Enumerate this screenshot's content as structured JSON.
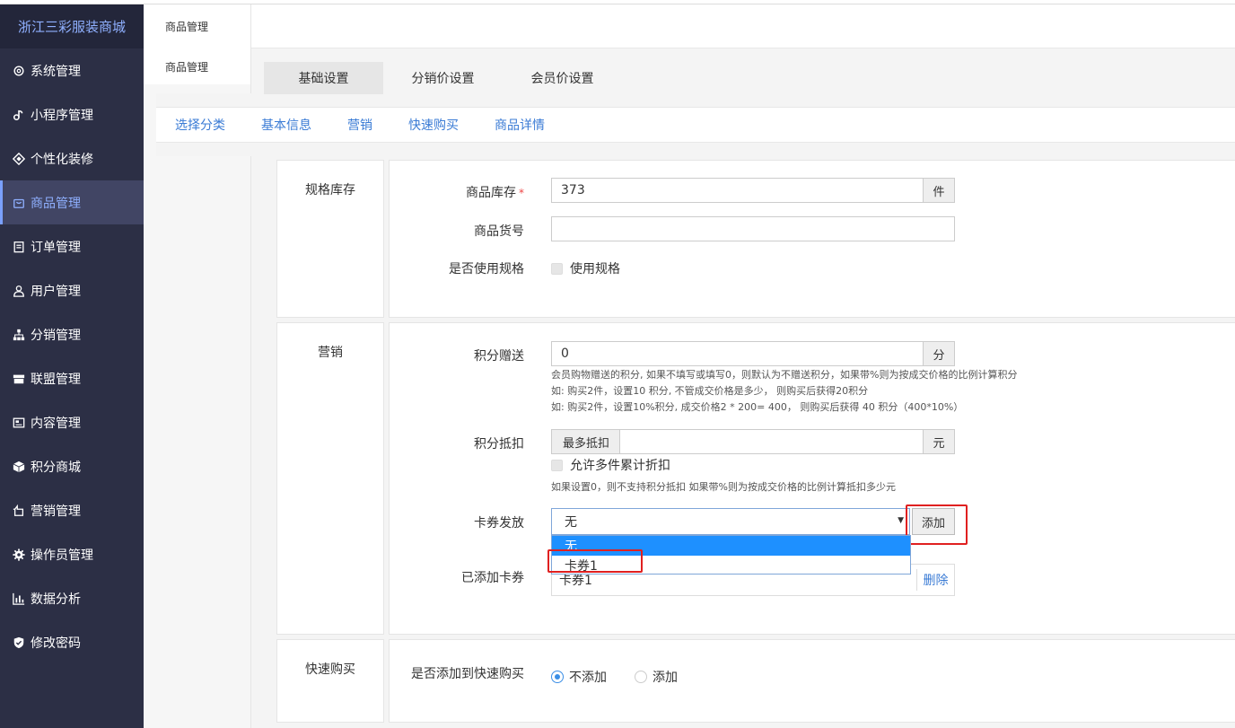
{
  "brand": "浙江三彩服装商城",
  "sidebar": {
    "items": [
      {
        "label": "系统管理",
        "icon": "gear-icon"
      },
      {
        "label": "小程序管理",
        "icon": "link-icon"
      },
      {
        "label": "个性化装修",
        "icon": "decor-icon"
      },
      {
        "label": "商品管理",
        "icon": "bag-icon"
      },
      {
        "label": "订单管理",
        "icon": "clipboard-icon"
      },
      {
        "label": "用户管理",
        "icon": "user-icon"
      },
      {
        "label": "分销管理",
        "icon": "hierarchy-icon"
      },
      {
        "label": "联盟管理",
        "icon": "store-icon"
      },
      {
        "label": "内容管理",
        "icon": "content-icon"
      },
      {
        "label": "积分商城",
        "icon": "cube-icon"
      },
      {
        "label": "营销管理",
        "icon": "marketing-icon"
      },
      {
        "label": "操作员管理",
        "icon": "cog-icon"
      },
      {
        "label": "数据分析",
        "icon": "chart-icon"
      },
      {
        "label": "修改密码",
        "icon": "shield-icon"
      }
    ],
    "active_index": 3
  },
  "subnav": {
    "items": [
      "商品管理",
      "商品管理"
    ]
  },
  "tabs": [
    "基础设置",
    "分销价设置",
    "会员价设置"
  ],
  "anchors": [
    "选择分类",
    "基本信息",
    "营销",
    "快速购买",
    "商品详情"
  ],
  "spec": {
    "section": "规格库存",
    "stock_label": "商品库存",
    "stock_value": "373",
    "stock_unit": "件",
    "sku_label": "商品货号",
    "sku_value": "",
    "use_spec_label": "是否使用规格",
    "use_spec_check": "使用规格"
  },
  "marketing": {
    "section": "营销",
    "points_label": "积分赠送",
    "points_value": "0",
    "points_unit": "分",
    "points_hint1": "会员购物赠送的积分, 如果不填写或填写0，则默认为不赠送积分，如果带%则为按成交价格的比例计算积分",
    "points_hint2": "如: 购买2件，设置10 积分, 不管成交价格是多少， 则购买后获得20积分",
    "points_hint3": "如: 购买2件，设置10%积分, 成交价格2 * 200= 400， 则购买后获得 40 积分（400*10%）",
    "deduct_label": "积分抵扣",
    "deduct_prefix": "最多抵扣",
    "deduct_value": "",
    "deduct_unit": "元",
    "deduct_check": "允许多件累计折扣",
    "deduct_hint": "如果设置0，则不支持积分抵扣 如果带%则为按成交价格的比例计算抵扣多少元",
    "coupon_label": "卡券发放",
    "coupon_selected": "无",
    "coupon_add": "添加",
    "coupon_options": [
      "无",
      "卡券1"
    ],
    "added_label": "已添加卡券",
    "added_coupon": "卡券1",
    "delete": "删除"
  },
  "quickbuy": {
    "section": "快速购买",
    "label": "是否添加到快速购买",
    "opt_no": "不添加",
    "opt_yes": "添加"
  }
}
